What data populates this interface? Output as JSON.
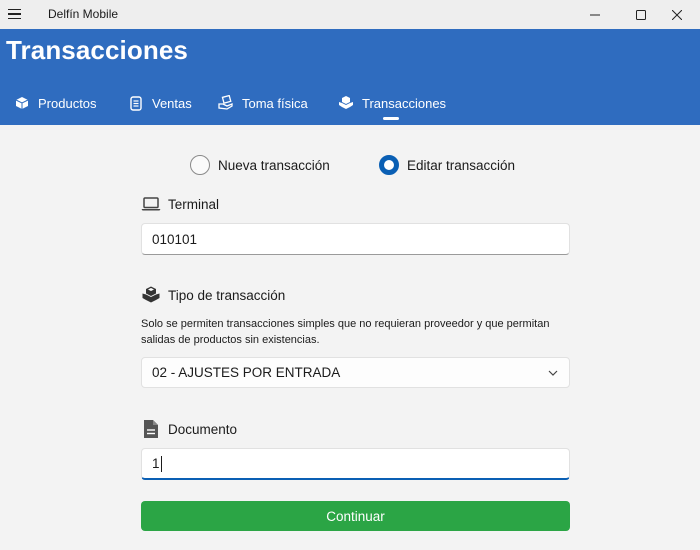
{
  "window": {
    "app_title": "Delfín Mobile"
  },
  "header": {
    "title": "Transacciones",
    "tabs": [
      {
        "label": "Productos",
        "icon": "cube-icon"
      },
      {
        "label": "Ventas",
        "icon": "receipt-icon"
      },
      {
        "label": "Toma física",
        "icon": "hand-box-icon"
      },
      {
        "label": "Transacciones",
        "icon": "boxes-icon",
        "selected": true
      }
    ]
  },
  "mode": {
    "options": [
      {
        "label": "Nueva transacción",
        "selected": false
      },
      {
        "label": "Editar transacción",
        "selected": true
      }
    ]
  },
  "terminal": {
    "label": "Terminal",
    "value": "010101"
  },
  "tipo": {
    "label": "Tipo de transacción",
    "help": "Solo se permiten transacciones simples que no requieran proveedor  y que permitan salidas de productos sin existencias.",
    "selected": "02 - AJUSTES POR ENTRADA"
  },
  "documento": {
    "label": "Documento",
    "value": "1"
  },
  "actions": {
    "continue_label": "Continuar"
  },
  "colors": {
    "header": "#2f6cbf",
    "accent": "#0a5fb4",
    "continue": "#2ba545"
  }
}
